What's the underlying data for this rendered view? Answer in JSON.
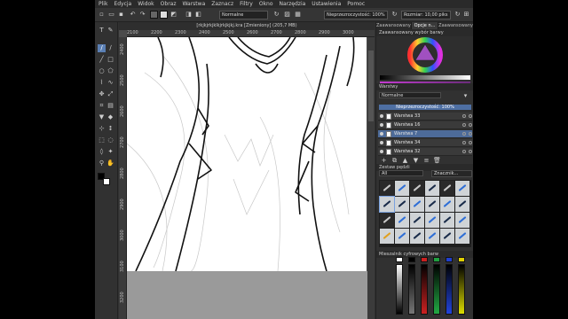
{
  "menu": [
    "Plik",
    "Edycja",
    "Widok",
    "Obraz",
    "Warstwa",
    "Zaznacz",
    "Filtry",
    "Okno",
    "Narzędzia",
    "Ustawienia",
    "Pomoc"
  ],
  "toolbar": {
    "blend_mode": "Normalne",
    "opacity": "Nieprzezroczystość: 100%",
    "size": "Rozmiar: 10,00 piks"
  },
  "document": {
    "title": "[rkjkjrkjklkjrkjkjkj.kra [Zmieniony] (205,7 MB)",
    "ruler_h": [
      "2100",
      "2200",
      "2300",
      "2400",
      "2500",
      "2600",
      "2700",
      "2800",
      "2900",
      "3000",
      "3100"
    ],
    "ruler_v": [
      "2400",
      "2500",
      "2600",
      "2700",
      "2800",
      "2900",
      "3000",
      "3100",
      "3200"
    ]
  },
  "dock": {
    "tabs": [
      "Zaawansowany wybór barwy",
      "Zaawansowany wybór...",
      "Opcje n...",
      "Zaawansowany wybór"
    ],
    "color_panel_title": "Zaawansowany wybór barwy",
    "layers_title": "Warstwy",
    "layers_mode": "Normalne",
    "layers_opacity": "Nieprzezroczystość: 100%",
    "layers": [
      {
        "name": "Warstwa 33",
        "selected": false
      },
      {
        "name": "Warstwa 16",
        "selected": false
      },
      {
        "name": "Warstwa 7",
        "selected": true
      },
      {
        "name": "Warstwa 34",
        "selected": false
      },
      {
        "name": "Warstwa 32",
        "selected": false
      }
    ],
    "brushes_title": "Zestaw pędzli",
    "brushes_filter": "All",
    "brushes_search": "Znacznik...",
    "sliders_title": "Mieszalnik cyfrowych barw"
  },
  "colors": {
    "slider_tops": [
      "#ffffff",
      "#000000",
      "#cc2020",
      "#20a040",
      "#2040d0",
      "#e0d000"
    ]
  }
}
